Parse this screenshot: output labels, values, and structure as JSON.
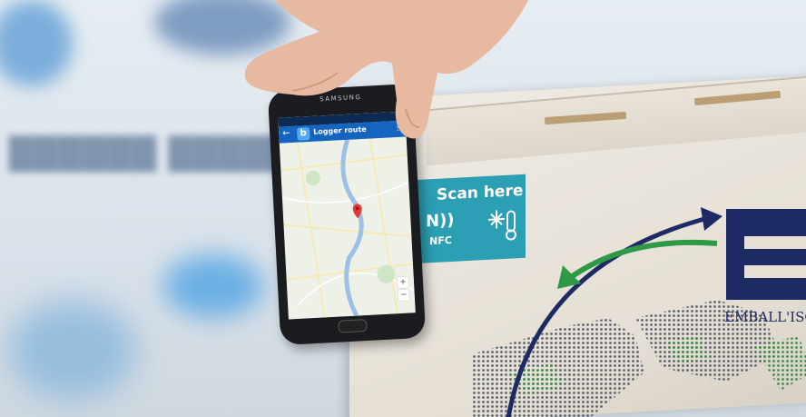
{
  "phone": {
    "brand": "SAMSUNG",
    "app_logo": "b",
    "app_title": "Logger route",
    "back_icon": "←",
    "menu_icon": "⋮",
    "zoom_in": "+",
    "zoom_out": "−"
  },
  "label": {
    "title": "Scan here",
    "nfc_text": "NFC",
    "nfc_icon": "N))",
    "accent_color": "#2b9fb3"
  },
  "box_brand": {
    "text": "EMBALL'ISO",
    "color": "#1e2a63"
  }
}
